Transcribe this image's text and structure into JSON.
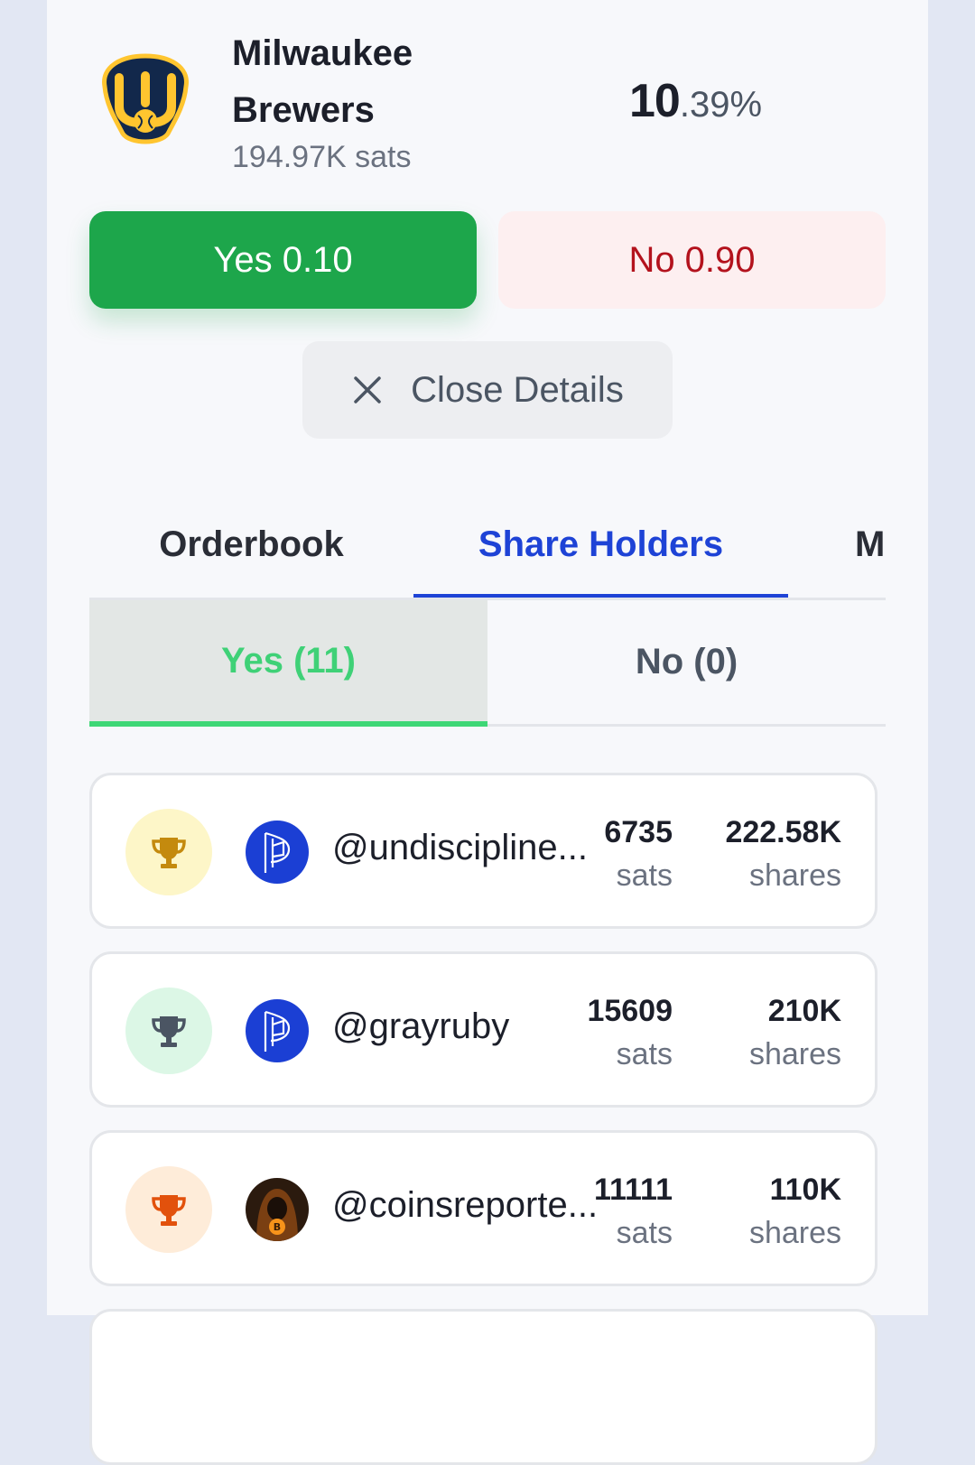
{
  "market": {
    "team_name": "Milwaukee Brewers",
    "volume": "194.97K sats",
    "probability_int": "10",
    "probability_dec": ".39%",
    "logo_icon": "brewers-glove-logo",
    "colors": {
      "navy": "#12284b",
      "gold": "#ffc52f"
    }
  },
  "actions": {
    "yes_label": "Yes 0.10",
    "no_label": "No 0.90",
    "close_label": "Close Details",
    "colors": {
      "yes": "#1da64b",
      "no_bg": "#fdeff0",
      "no_text": "#b3121d"
    }
  },
  "tabs": [
    {
      "label": "Orderbook",
      "active": false
    },
    {
      "label": "Share Holders",
      "active": true
    },
    {
      "label": "M",
      "active": false
    }
  ],
  "subtabs": [
    {
      "label": "Yes (11)",
      "active": true
    },
    {
      "label": "No (0)",
      "active": false
    }
  ],
  "holders": [
    {
      "handle": "@undiscipline...",
      "sats": "6735",
      "sats_unit": "sats",
      "shares": "222.58K",
      "shares_unit": "shares",
      "trophy_icon": "gold-trophy-icon",
      "trophy_color": "#c48a0e",
      "trophy_bg": "#fdf6c8",
      "avatar_icon": "primal-logo-avatar"
    },
    {
      "handle": "@grayruby",
      "sats": "15609",
      "sats_unit": "sats",
      "shares": "210K",
      "shares_unit": "shares",
      "trophy_icon": "silver-trophy-icon",
      "trophy_color": "#4b5563",
      "trophy_bg": "#dcf7e6",
      "avatar_icon": "primal-logo-avatar"
    },
    {
      "handle": "@coinsreporte...",
      "sats": "11111",
      "sats_unit": "sats",
      "shares": "110K",
      "shares_unit": "shares",
      "trophy_icon": "bronze-trophy-icon",
      "trophy_color": "#e2510c",
      "trophy_bg": "#feecd9",
      "avatar_icon": "hooded-bitcoin-avatar"
    }
  ]
}
